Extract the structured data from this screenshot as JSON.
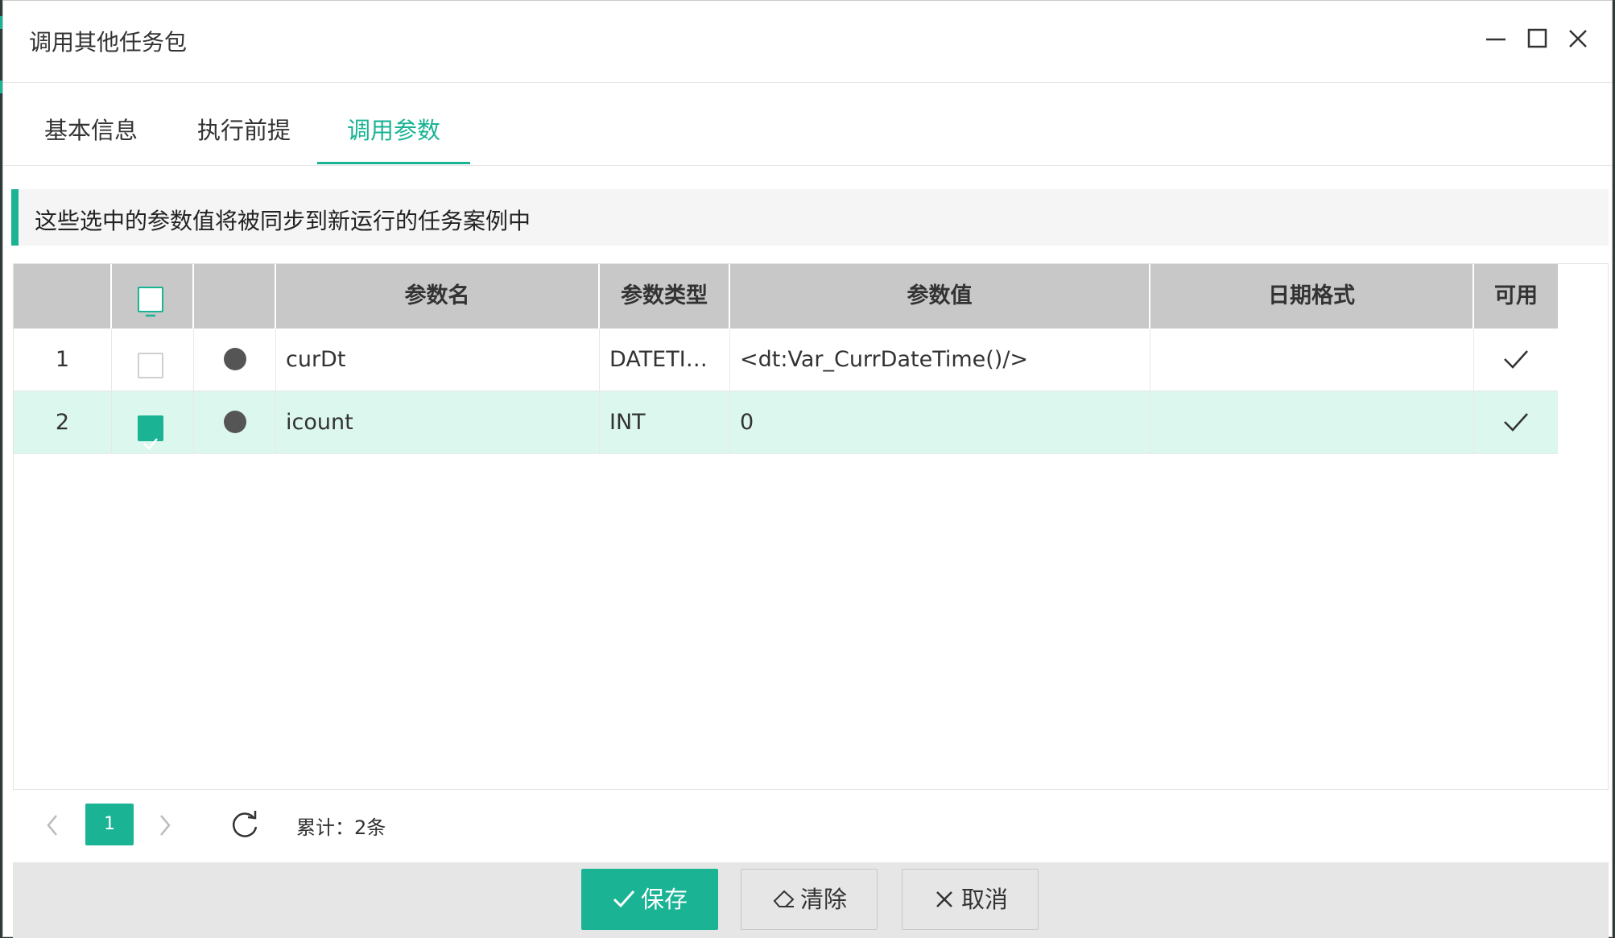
{
  "window": {
    "title": "调用其他任务包"
  },
  "tabs": [
    {
      "label": "基本信息",
      "active": false
    },
    {
      "label": "执行前提",
      "active": false
    },
    {
      "label": "调用参数",
      "active": true
    }
  ],
  "info": {
    "text": "这些选中的参数值将被同步到新运行的任务案例中"
  },
  "table": {
    "headers": {
      "name": "参数名",
      "type": "参数类型",
      "value": "参数值",
      "date_format": "日期格式",
      "enabled": "可用"
    },
    "rows": [
      {
        "index": "1",
        "checked": false,
        "name": "curDt",
        "type": "DATETI…",
        "value": "<dt:Var_CurrDateTime()/>",
        "date_format": "",
        "enabled": true
      },
      {
        "index": "2",
        "checked": true,
        "name": "icount",
        "type": "INT",
        "value": "0",
        "date_format": "",
        "enabled": true
      }
    ]
  },
  "pager": {
    "current_page": "1",
    "total": "累计：2条"
  },
  "footer": {
    "save_label": "保存",
    "clear_label": "清除",
    "cancel_label": "取消"
  },
  "colors": {
    "accent": "#1ab394",
    "header_bg": "#c8c8c8",
    "selected_row": "#dcf7ee"
  }
}
